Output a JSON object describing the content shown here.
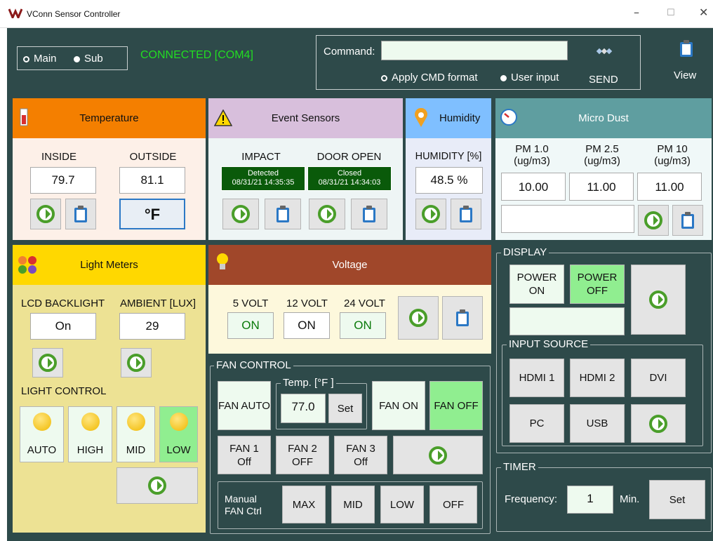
{
  "window": {
    "title": "VConn Sensor Controller",
    "min": "–",
    "max": "☐",
    "close": "✕"
  },
  "top": {
    "mode_main": "Main",
    "mode_sub": "Sub",
    "status": "CONNECTED [COM4]",
    "command_label": "Command:",
    "command_value": "",
    "opt_apply": "Apply CMD format",
    "opt_user": "User input",
    "send": "SEND",
    "view": "View"
  },
  "temperature": {
    "title": "Temperature",
    "inside_label": "INSIDE",
    "outside_label": "OUTSIDE",
    "inside": "79.7",
    "outside": "81.1",
    "unit": "°F"
  },
  "events": {
    "title": "Event Sensors",
    "impact_label": "IMPACT",
    "door_label": "DOOR OPEN",
    "impact_status": "Detected",
    "impact_time": "08/31/21 14:35:35",
    "door_status": "Closed",
    "door_time": "08/31/21 14:34:03"
  },
  "humidity": {
    "title": "Humidity",
    "label": "HUMIDITY [%]",
    "value": "48.5 %"
  },
  "dust": {
    "title": "Micro Dust",
    "pm1_label": "PM 1.0",
    "pm25_label": "PM 2.5",
    "pm10_label": "PM 10",
    "unit": "(ug/m3)",
    "pm1": "10.00",
    "pm25": "11.00",
    "pm10": "11.00",
    "extra": ""
  },
  "light": {
    "title": "Light Meters",
    "lcd_label": "LCD BACKLIGHT",
    "ambient_label": "AMBIENT [LUX]",
    "lcd": "On",
    "ambient": "29",
    "control_label": "LIGHT CONTROL",
    "auto": "AUTO",
    "high": "HIGH",
    "mid": "MID",
    "low": "LOW"
  },
  "voltage": {
    "title": "Voltage",
    "v5_label": "5 VOLT",
    "v12_label": "12 VOLT",
    "v24_label": "24 VOLT",
    "v5": "ON",
    "v12": "ON",
    "v24": "ON"
  },
  "fan": {
    "group": "FAN CONTROL",
    "auto": "FAN AUTO",
    "temp_label": "Temp. [°F ]",
    "temp": "77.0",
    "set": "Set",
    "on": "FAN ON",
    "off": "FAN OFF",
    "fan1_name": "FAN 1",
    "fan1_state": "Off",
    "fan2_name": "FAN 2",
    "fan2_state": "OFF",
    "fan3_name": "FAN 3",
    "fan3_state": "Off",
    "manual_label": "Manual FAN Ctrl",
    "max": "MAX",
    "mid": "MID",
    "low": "LOW",
    "moff": "OFF"
  },
  "display": {
    "group": "DISPLAY",
    "power_on": "POWER ON",
    "power_off": "POWER OFF",
    "field": "",
    "input_group": "INPUT SOURCE",
    "hdmi1": "HDMI 1",
    "hdmi2": "HDMI 2",
    "dvi": "DVI",
    "pc": "PC",
    "usb": "USB"
  },
  "timer": {
    "group": "TIMER",
    "freq_label": "Frequency:",
    "freq": "1",
    "unit": "Min.",
    "set": "Set"
  },
  "colors": {
    "bg": "#2e4a4a",
    "connected": "#22dd22",
    "temp_head": "#f47f00",
    "event_head": "#d8bfdc",
    "humid_head": "#7fbfff",
    "dust_head": "#5f9ea0",
    "light_head": "#ffd800",
    "volt_head": "#a0472a",
    "on_green": "#90ee90"
  }
}
